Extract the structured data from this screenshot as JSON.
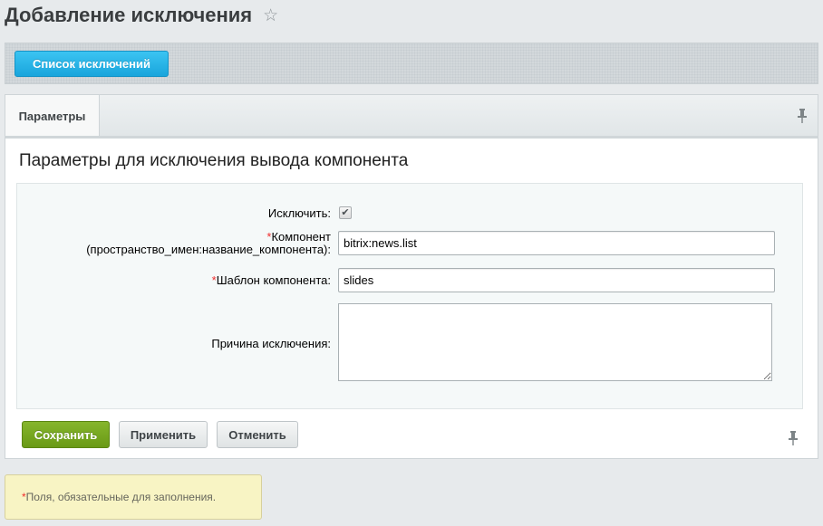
{
  "header": {
    "title": "Добавление исключения",
    "star_icon": "star-outline-icon"
  },
  "context_bar": {
    "list_button_label": "Список исключений"
  },
  "tabs": [
    {
      "label": "Параметры",
      "active": true
    }
  ],
  "pin_icon": "pin-icon",
  "section": {
    "title": "Параметры для исключения вывода компонента"
  },
  "form": {
    "exclude_label": "Исключить:",
    "exclude_checked": true,
    "component_label_line1": "Компонент",
    "component_label_line2": "(пространство_имен:название_компонента):",
    "component_value": "bitrix:news.list",
    "template_label": "Шаблон компонента:",
    "template_value": "slides",
    "reason_label": "Причина исключения:",
    "reason_value": "",
    "required_mark": "*"
  },
  "buttons": {
    "save": "Сохранить",
    "apply": "Применить",
    "cancel": "Отменить"
  },
  "note": {
    "required_mark": "*",
    "text": "Поля, обязательные для заполнения."
  },
  "colors": {
    "accent_blue": "#23afe3",
    "save_green": "#7aa81f",
    "required_red": "#ef2d2d",
    "note_bg": "#f8f4c4"
  }
}
